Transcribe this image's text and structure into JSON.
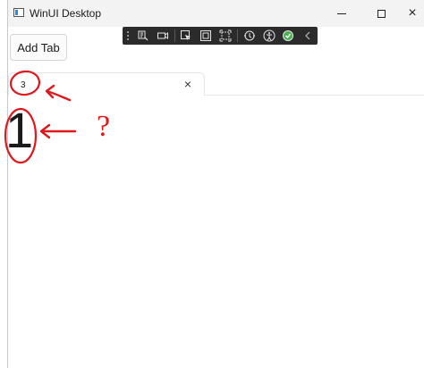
{
  "window": {
    "title": "WinUI Desktop",
    "controls": {
      "minimize": "minimize",
      "maximize": "maximize",
      "close": "×"
    }
  },
  "debug_toolbar": {
    "icons": [
      "live-visual-tree-icon",
      "video-camera-icon",
      "select-element-icon",
      "display-layout-adorners-icon",
      "track-focus-icon",
      "hot-reload-icon",
      "accessibility-icon",
      "check-circle-icon",
      "collapse-chevron-icon"
    ],
    "accent_color": "#4caf50"
  },
  "add_tab_button": {
    "label": "Add Tab"
  },
  "tabs": [
    {
      "label": "3",
      "close": "×"
    }
  ],
  "content": {
    "text": "1"
  },
  "annotations": {
    "question": "?",
    "color": "#e0171c"
  }
}
